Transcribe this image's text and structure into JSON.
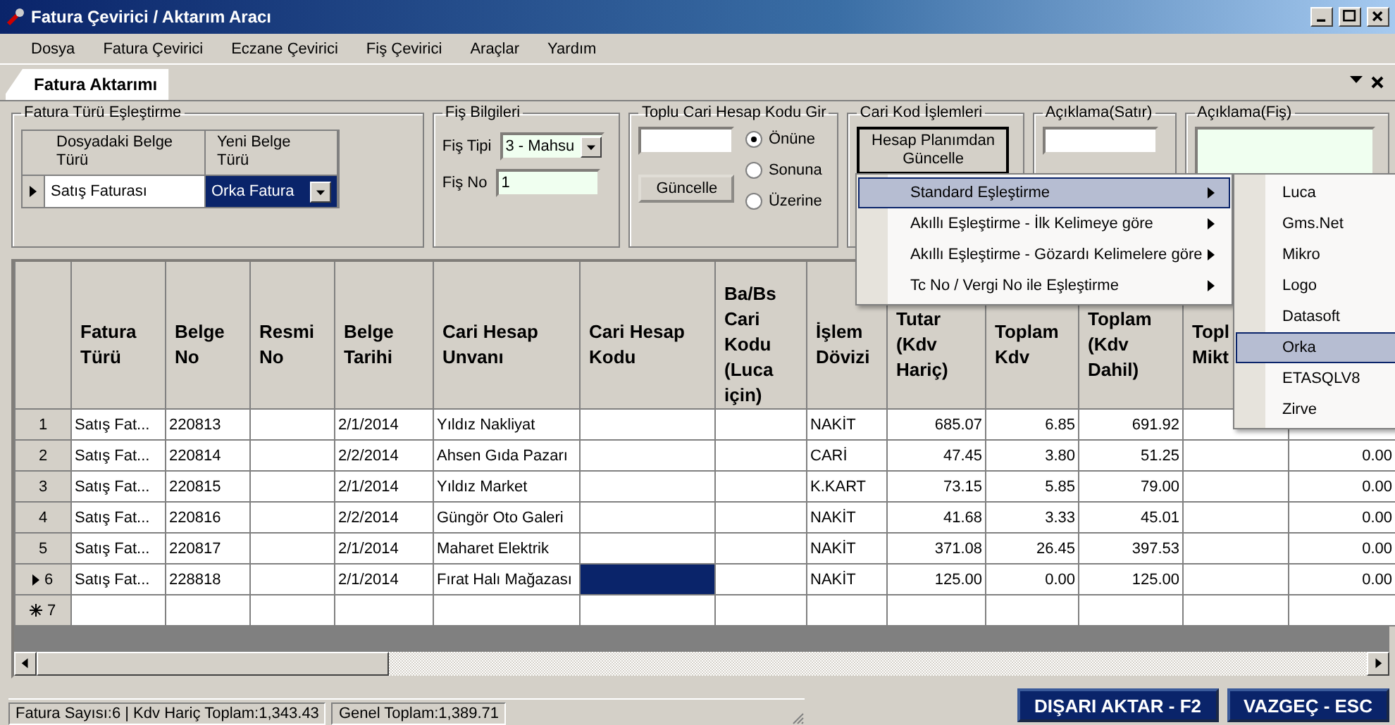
{
  "window": {
    "title": "Fatura Çevirici / Aktarım Aracı"
  },
  "menu_bar": [
    "Dosya",
    "Fatura Çevirici",
    "Eczane Çevirici",
    "Fiş Çevirici",
    "Araçlar",
    "Yardım"
  ],
  "tabs": [
    {
      "label": "Fatura Aktarımı",
      "selected": true
    }
  ],
  "mapping_group": {
    "title": "Fatura Türü Eşleştirme",
    "columns": [
      "Dosyadaki Belge Türü",
      "Yeni Belge Türü"
    ],
    "rows": [
      {
        "source": "Satış Faturası",
        "target": "Orka Fatura",
        "current": true
      }
    ]
  },
  "voucher_group": {
    "title": "Fiş Bilgileri",
    "type_label": "Fiş Tipi",
    "type_value": "3 - Mahsu",
    "no_label": "Fiş No",
    "no_value": "1"
  },
  "bulk_group": {
    "title": "Toplu Cari Hesap Kodu Gir",
    "button": "Güncelle",
    "options": [
      {
        "label": "Önüne",
        "selected": true
      },
      {
        "label": "Sonuna",
        "selected": false
      },
      {
        "label": "Üzerine",
        "selected": false
      }
    ]
  },
  "account_group": {
    "title": "Cari Kod İşlemleri",
    "button": "Hesap Planımdan Güncelle"
  },
  "line_note_group": {
    "title": "Açıklama(Satır)"
  },
  "voucher_note_group": {
    "title": "Açıklama(Fiş)"
  },
  "table": {
    "columns": [
      "Fatura Türü",
      "Belge No",
      "Resmi No",
      "Belge Tarihi",
      "Cari Hesap Unvanı",
      "Cari Hesap Kodu",
      "Ba/Bs Cari Kodu (Luca için)",
      "İşlem Dövizi",
      "Tutar (Kdv Hariç)",
      "Toplam Kdv",
      "Toplam (Kdv Dahil)",
      "Topl\nMikt"
    ],
    "rows": [
      {
        "header": "1",
        "current": false,
        "code_selected": false,
        "type": "Satış Fat...",
        "doc_no": "220813",
        "date": "2/1/2014",
        "account_name": "Yıldız Nakliyat",
        "currency": "NAKİT",
        "amount": "685.07",
        "vat": "6.85",
        "total": "691.92"
      },
      {
        "header": "2",
        "current": false,
        "code_selected": false,
        "type": "Satış Fat...",
        "doc_no": "220814",
        "date": "2/2/2014",
        "account_name": "Ahsen Gıda Pazarı",
        "currency": "CARİ",
        "amount": "47.45",
        "vat": "3.80",
        "total": "51.25",
        "column_13": "0.00"
      },
      {
        "header": "3",
        "current": false,
        "code_selected": false,
        "type": "Satış Fat...",
        "doc_no": "220815",
        "date": "2/1/2014",
        "account_name": "Yıldız Market",
        "currency": "K.KART",
        "amount": "73.15",
        "vat": "5.85",
        "total": "79.00",
        "column_13": "0.00"
      },
      {
        "header": "4",
        "current": false,
        "code_selected": false,
        "type": "Satış Fat...",
        "doc_no": "220816",
        "date": "2/2/2014",
        "account_name": "Güngör Oto Galeri",
        "currency": "NAKİT",
        "amount": "41.68",
        "vat": "3.33",
        "total": "45.01",
        "column_13": "0.00"
      },
      {
        "header": "5",
        "current": false,
        "code_selected": false,
        "type": "Satış Fat...",
        "doc_no": "220817",
        "date": "2/1/2014",
        "account_name": "Maharet Elektrik",
        "currency": "NAKİT",
        "amount": "371.08",
        "vat": "26.45",
        "total": "397.53",
        "column_13": "0.00"
      },
      {
        "header": "6",
        "current": true,
        "code_selected": true,
        "type": "Satış Fat...",
        "doc_no": "228818",
        "date": "2/1/2014",
        "account_name": "Fırat Halı Mağazası",
        "currency": "NAKİT",
        "amount": "125.00",
        "vat": "0.00",
        "total": "125.00",
        "column_13": "0.00"
      }
    ],
    "new_row": {
      "header": "7"
    }
  },
  "context_menu": {
    "items": [
      {
        "label": "Standard Eşleştirme",
        "selected": true
      },
      {
        "label": "Akıllı Eşleştirme - İlk Kelimeye göre",
        "selected": false
      },
      {
        "label": "Akıllı Eşleştirme - Gözardı Kelimelere göre",
        "selected": false
      },
      {
        "label": "Tc No / Vergi No ile Eşleştirme",
        "selected": false
      }
    ]
  },
  "submenu": {
    "items": [
      {
        "label": "Luca",
        "selected": false
      },
      {
        "label": "Gms.Net",
        "selected": false
      },
      {
        "label": "Mikro",
        "selected": false
      },
      {
        "label": "Logo",
        "selected": false
      },
      {
        "label": "Datasoft",
        "selected": false
      },
      {
        "label": "Orka",
        "selected": true
      },
      {
        "label": "ETASQLV8",
        "selected": false
      },
      {
        "label": "Zirve",
        "selected": false
      }
    ]
  },
  "status_bar": {
    "items": [
      "Fatura Sayısı:6 | Kdv Hariç Toplam:1,343.43",
      "Genel Toplam:1,389.71"
    ]
  },
  "buttons": [
    "DIŞARI AKTAR - F2",
    "VAZGEÇ - ESC"
  ]
}
